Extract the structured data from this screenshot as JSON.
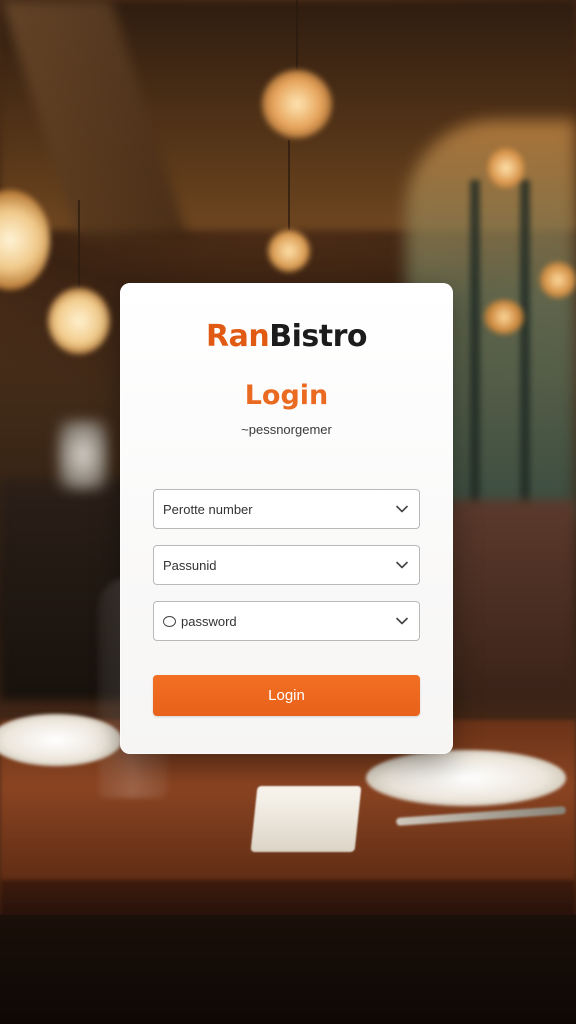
{
  "brand": {
    "accent_part": "Ran",
    "rest_part": "Bistro"
  },
  "login": {
    "title": "Login",
    "subtitle": "~pessnorgemer",
    "fields": [
      {
        "label": "Perotte number",
        "icon": "chevron-down-icon"
      },
      {
        "label": "Passunid",
        "icon": "chevron-down-icon"
      },
      {
        "label": "password",
        "leading_icon": "radio-circle-icon",
        "icon": "chevron-down-icon"
      }
    ],
    "submit_label": "Login"
  },
  "colors": {
    "accent": "#e96a20",
    "button": "#f06b22",
    "card": "#ffffff",
    "text": "#1c1c1c"
  }
}
